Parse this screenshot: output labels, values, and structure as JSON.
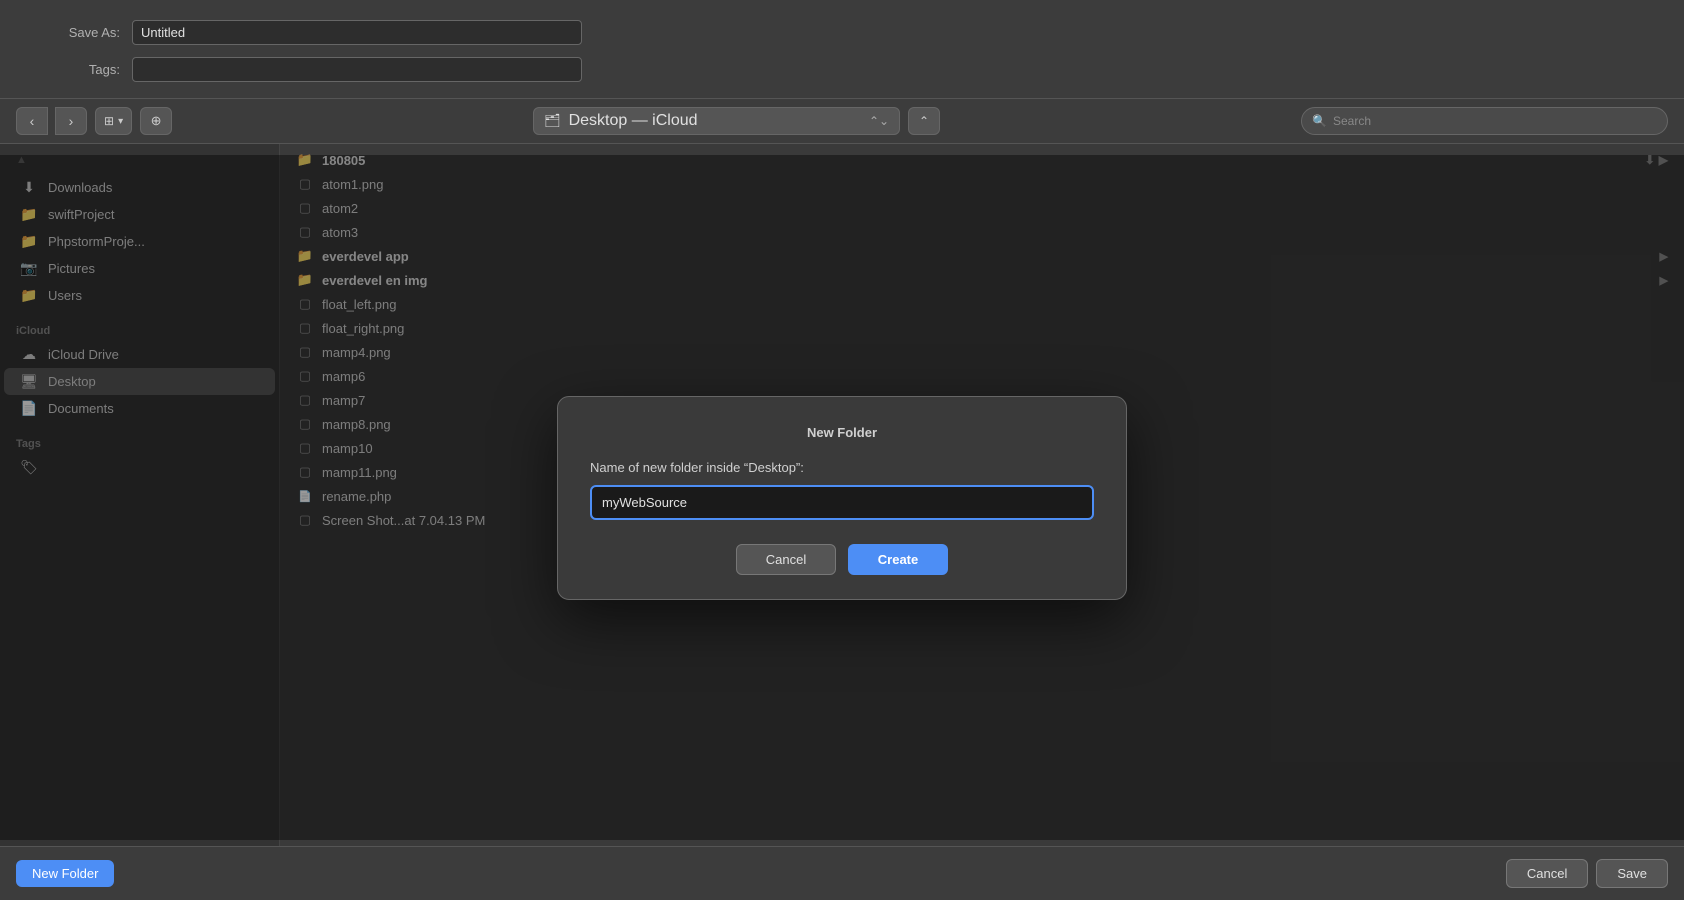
{
  "dialog": {
    "title": "New Folder",
    "prompt": "Name of new folder inside “Desktop”:",
    "input_value": "myWebSource",
    "cancel_label": "Cancel",
    "create_label": "Create"
  },
  "top_form": {
    "save_as_label": "Save As:",
    "tags_label": "Tags:",
    "save_as_value": "Untitled",
    "tags_value": ""
  },
  "toolbar": {
    "back_icon": "‹",
    "forward_icon": "›",
    "view_icon": "☰",
    "new_folder_icon": "⬜",
    "location": "Desktop — iCloud",
    "location_icon": "⎕",
    "expand_icon": "⌃",
    "search_placeholder": "Search",
    "search_icon": "🔍"
  },
  "sidebar": {
    "section_favorites": "",
    "items": [
      {
        "id": "downloads",
        "label": "Downloads",
        "icon": "⬇",
        "active": false
      },
      {
        "id": "swiftProject",
        "label": "swiftProject",
        "icon": "📁",
        "active": false
      },
      {
        "id": "phpstormProje",
        "label": "PhpstormProje...",
        "icon": "📁",
        "active": false
      },
      {
        "id": "pictures",
        "label": "Pictures",
        "icon": "📸",
        "active": false
      },
      {
        "id": "users",
        "label": "Users",
        "icon": "📁",
        "active": false
      }
    ],
    "section_icloud": "iCloud",
    "icloud_items": [
      {
        "id": "icloud-drive",
        "label": "iCloud Drive",
        "icon": "☁",
        "active": false
      },
      {
        "id": "desktop",
        "label": "Desktop",
        "icon": "🖥",
        "active": true
      },
      {
        "id": "documents",
        "label": "Documents",
        "icon": "📄",
        "active": false
      }
    ],
    "section_tags": "Tags"
  },
  "file_list": {
    "items": [
      {
        "name": "180805",
        "type": "folder_blue",
        "has_chevron": true,
        "has_cloud": true
      },
      {
        "name": "atom1.png",
        "type": "file_gray",
        "has_chevron": false
      },
      {
        "name": "atom2",
        "type": "file_gray",
        "has_chevron": false
      },
      {
        "name": "atom3",
        "type": "file_gray",
        "has_chevron": false
      },
      {
        "name": "everdevel app",
        "type": "folder_blue",
        "has_chevron": true
      },
      {
        "name": "everdevel en img",
        "type": "folder_blue",
        "has_chevron": true
      },
      {
        "name": "float_left.png",
        "type": "file_gray",
        "has_chevron": false
      },
      {
        "name": "float_right.png",
        "type": "file_gray",
        "has_chevron": false
      },
      {
        "name": "mamp4.png",
        "type": "file_gray",
        "has_chevron": false
      },
      {
        "name": "mamp6",
        "type": "file_gray",
        "has_chevron": false
      },
      {
        "name": "mamp7",
        "type": "file_gray",
        "has_chevron": false
      },
      {
        "name": "mamp8.png",
        "type": "file_gray",
        "has_chevron": false
      },
      {
        "name": "mamp10",
        "type": "file_gray",
        "has_chevron": false
      },
      {
        "name": "mamp11.png",
        "type": "file_gray",
        "has_chevron": false
      },
      {
        "name": "rename.php",
        "type": "file_doc",
        "has_chevron": false
      },
      {
        "name": "Screen Shot...at 7.04.13 PM",
        "type": "file_gray",
        "has_chevron": false
      }
    ]
  },
  "bottom_bar": {
    "new_folder_label": "New Folder",
    "cancel_label": "Cancel",
    "save_label": "Save"
  }
}
